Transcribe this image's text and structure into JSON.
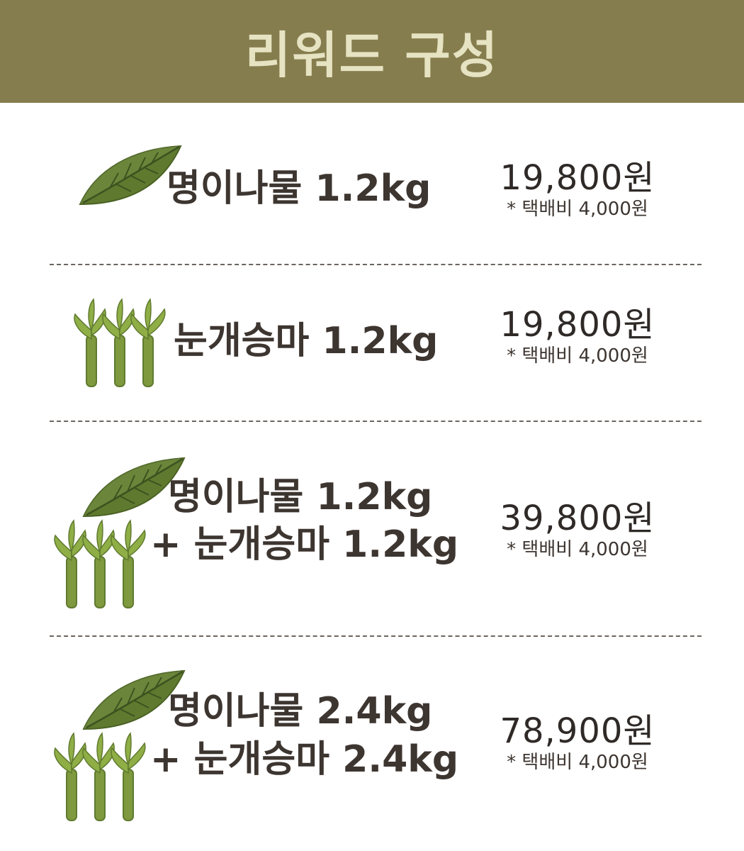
{
  "header": {
    "title": "리워드 구성"
  },
  "rewards": [
    {
      "item": "명이나물 1.2kg",
      "price": "19,800원",
      "shipping": "* 택배비 4,000원"
    },
    {
      "item": "눈개승마 1.2kg",
      "price": "19,800원",
      "shipping": "* 택배비 4,000원"
    },
    {
      "item_line1": "명이나물 1.2kg",
      "item_line2": "+ 눈개승마 1.2kg",
      "price": "39,800원",
      "shipping": "* 택배비 4,000원"
    },
    {
      "item_line1": "명이나물 2.4kg",
      "item_line2": "+ 눈개승마 2.4kg",
      "price": "78,900원",
      "shipping": "* 택배비 4,000원"
    }
  ],
  "icons": {
    "leaf": "leaf-icon",
    "sprouts": "sprouts-icon"
  },
  "colors": {
    "header_bg": "#867d4e",
    "header_text": "#e6e3c3",
    "leaf_green": "#5f7a2f",
    "sprout_green": "#7f9a3e",
    "text_dark": "#3d3530"
  }
}
